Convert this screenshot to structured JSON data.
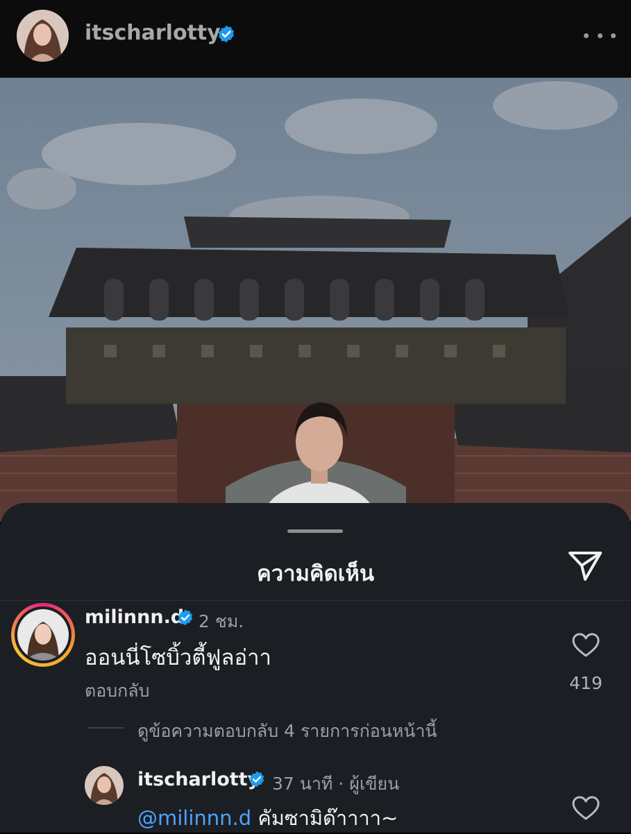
{
  "header": {
    "username": "itscharlotty",
    "verified": true,
    "more_icon": "more-horizontal-icon"
  },
  "photo": {
    "subject": "woman in white blouse in front of a traditional Korean palace gate"
  },
  "comments_sheet": {
    "title": "ความคิดเห็น",
    "share_icon": "paper-plane-icon"
  },
  "comments": [
    {
      "username": "milinnn.d",
      "verified": true,
      "time": "2 ชม.",
      "text": "ออนนี่โซบิ้วตี้ฟูลอ่าา",
      "reply_label": "ตอบกลับ",
      "likes": "419"
    }
  ],
  "view_replies_label": "ดูข้อความตอบกลับ 4 รายการก่อนหน้านี้",
  "reply": {
    "username": "itscharlotty",
    "verified": true,
    "time": "37 นาที",
    "separator": "·",
    "author_badge": "ผู้เขียน",
    "mention": "@milinnn.d",
    "text": "คัมซามิด๊าาาา~"
  },
  "colors": {
    "background": "#000000",
    "sheet": "#1b1e23",
    "verified": "#1d9bf0",
    "mention": "#4da3ff",
    "secondary_text": "#9ba0a6"
  }
}
